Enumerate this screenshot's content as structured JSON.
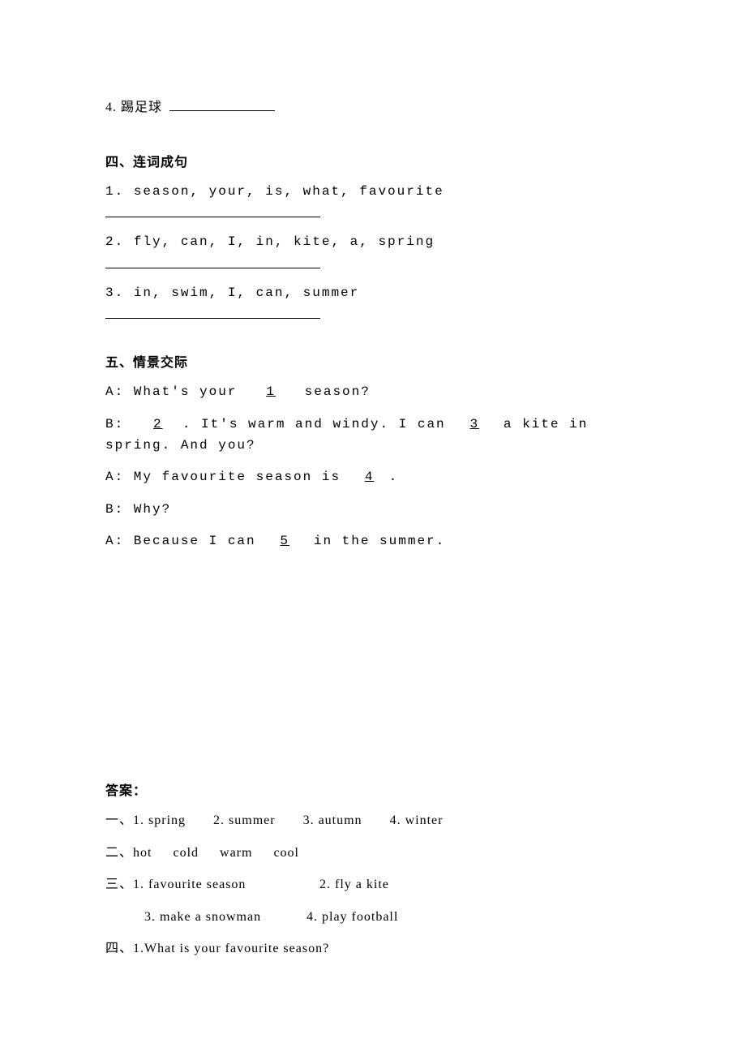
{
  "q3_item4": {
    "number": "4.",
    "label_cn": "踢足球"
  },
  "section4": {
    "title": "四、连词成句",
    "items": [
      {
        "num": "1.",
        "words": "season, your, is, what, favourite"
      },
      {
        "num": "2.",
        "words": "fly, can, I, in, kite, a, spring"
      },
      {
        "num": "3.",
        "words": "in, swim, I, can, summer"
      }
    ]
  },
  "section5": {
    "title": "五、情景交际",
    "lines": {
      "l1_pre": "A: What's your ",
      "l1_b": "1",
      "l1_post": " season?",
      "l2_pre": "B: ",
      "l2_b1": "2",
      "l2_mid1": ". It's warm and windy. I can ",
      "l2_b2": "3",
      "l2_post": " a kite in spring. And you?",
      "l3_pre": "A: My favourite season is ",
      "l3_b": "4",
      "l3_post": ".",
      "l4": "B: Why?",
      "l5_pre": "A: Because I can ",
      "l5_b": "5",
      "l5_post": " in the summer."
    }
  },
  "answers": {
    "title": "答案：",
    "a1": {
      "prefix": "一、",
      "items": [
        "1. spring",
        "2. summer",
        "3. autumn",
        "4. winter"
      ]
    },
    "a2": {
      "prefix": "二、",
      "items": [
        "hot",
        "cold",
        "warm",
        "cool"
      ]
    },
    "a3": {
      "prefix": "三、",
      "row1": [
        "1. favourite season",
        "2. fly a kite"
      ],
      "row2": [
        "3. make a snowman",
        "4. play football"
      ]
    },
    "a4": {
      "prefix": "四、",
      "first": "1.What is your favourite season?"
    }
  }
}
